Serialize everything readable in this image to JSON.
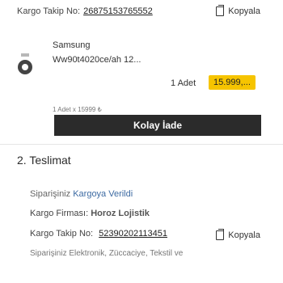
{
  "tracking_top": {
    "label": "Kargo Takip No:",
    "number": "26875153765552",
    "copy_label": "Kopyala"
  },
  "product": {
    "brand": "Samsung",
    "sku": "Ww90t4020ce/ah 12...",
    "quantity": "1 Adet",
    "price": "15.999,...",
    "quantity_line": "1 Adet x 15999 ₺"
  },
  "cta": {
    "label": "Kolay İade"
  },
  "section": {
    "title": "2. Teslimat"
  },
  "delivery": {
    "status_prefix": "Siparişiniz",
    "status_hl": "Kargoya Verildi",
    "carrier_label": "Kargo Firması:",
    "carrier_name": "Horoz Lojistik",
    "tracking_label": "Kargo Takip No:",
    "tracking_number": "52390202113451",
    "copy_label": "Kopyala",
    "note": "Siparişiniz Elektronik, Züccaciye, Tekstil ve"
  },
  "colors": {
    "price_badge": "#f6c400",
    "cta_bg": "#2b2b2b",
    "status_highlight": "#3c6aa2"
  }
}
